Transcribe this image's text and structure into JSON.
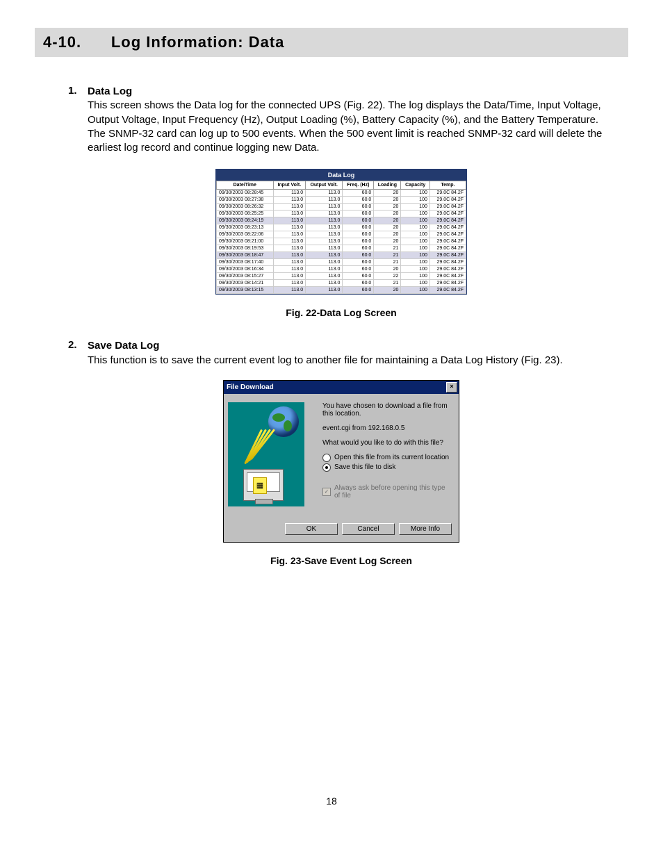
{
  "section": {
    "number": "4-10.",
    "title": "Log Information: Data"
  },
  "item1": {
    "num": "1.",
    "title": "Data Log",
    "body": "This screen shows the Data log for the connected UPS (Fig. 22).  The log displays the Data/Time, Input Voltage, Output Voltage, Input Frequency (Hz), Output Loading (%), Battery Capacity (%), and the Battery Temperature.  The SNMP-32 card can log up to 500 events.  When the 500 event limit is reached SNMP-32 card will delete the earliest log record and continue logging new Data."
  },
  "datalog": {
    "title": "Data Log",
    "headers": [
      "Date/Time",
      "Input Volt.",
      "Output Volt.",
      "Freq. (Hz)",
      "Loading",
      "Capacity",
      "Temp."
    ],
    "rows": [
      {
        "dt": "09/30/2003 08:28:45",
        "iv": "113.0",
        "ov": "113.0",
        "fr": "60.0",
        "ld": "20",
        "cp": "100",
        "tp": "29.0C 84.2F"
      },
      {
        "dt": "09/30/2003 08:27:38",
        "iv": "113.0",
        "ov": "113.0",
        "fr": "60.0",
        "ld": "20",
        "cp": "100",
        "tp": "29.0C 84.2F"
      },
      {
        "dt": "09/30/2003 08:26:32",
        "iv": "113.0",
        "ov": "113.0",
        "fr": "60.0",
        "ld": "20",
        "cp": "100",
        "tp": "29.0C 84.2F"
      },
      {
        "dt": "09/30/2003 08:25:25",
        "iv": "113.0",
        "ov": "113.0",
        "fr": "60.0",
        "ld": "20",
        "cp": "100",
        "tp": "29.0C 84.2F"
      },
      {
        "dt": "09/30/2003 08:24:19",
        "iv": "113.0",
        "ov": "113.0",
        "fr": "60.0",
        "ld": "20",
        "cp": "100",
        "tp": "29.0C 84.2F",
        "shade": true
      },
      {
        "dt": "09/30/2003 08:23:13",
        "iv": "113.0",
        "ov": "113.0",
        "fr": "60.0",
        "ld": "20",
        "cp": "100",
        "tp": "29.0C 84.2F"
      },
      {
        "dt": "09/30/2003 08:22:06",
        "iv": "113.0",
        "ov": "113.0",
        "fr": "60.0",
        "ld": "20",
        "cp": "100",
        "tp": "29.0C 84.2F"
      },
      {
        "dt": "09/30/2003 08:21:00",
        "iv": "113.0",
        "ov": "113.0",
        "fr": "60.0",
        "ld": "20",
        "cp": "100",
        "tp": "29.0C 84.2F"
      },
      {
        "dt": "09/30/2003 08:19:53",
        "iv": "113.0",
        "ov": "113.0",
        "fr": "60.0",
        "ld": "21",
        "cp": "100",
        "tp": "29.0C 84.2F"
      },
      {
        "dt": "09/30/2003 08:18:47",
        "iv": "113.0",
        "ov": "113.0",
        "fr": "60.0",
        "ld": "21",
        "cp": "100",
        "tp": "29.0C 84.2F",
        "shade": true
      },
      {
        "dt": "09/30/2003 08:17:40",
        "iv": "113.0",
        "ov": "113.0",
        "fr": "60.0",
        "ld": "21",
        "cp": "100",
        "tp": "29.0C 84.2F"
      },
      {
        "dt": "09/30/2003 08:16:34",
        "iv": "113.0",
        "ov": "113.0",
        "fr": "60.0",
        "ld": "20",
        "cp": "100",
        "tp": "29.0C 84.2F"
      },
      {
        "dt": "09/30/2003 08:15:27",
        "iv": "113.0",
        "ov": "113.0",
        "fr": "60.0",
        "ld": "22",
        "cp": "100",
        "tp": "29.0C 84.2F"
      },
      {
        "dt": "09/30/2003 08:14:21",
        "iv": "113.0",
        "ov": "113.0",
        "fr": "60.0",
        "ld": "21",
        "cp": "100",
        "tp": "29.0C 84.2F"
      },
      {
        "dt": "09/30/2003 08:13:15",
        "iv": "113.0",
        "ov": "113.0",
        "fr": "60.0",
        "ld": "20",
        "cp": "100",
        "tp": "29.0C 84.2F",
        "shade": true
      }
    ]
  },
  "fig22": "Fig. 22-Data Log Screen",
  "item2": {
    "num": "2.",
    "title": "Save Data Log",
    "body": "This function is to save the current event log to another file for maintaining a Data Log History (Fig. 23)."
  },
  "dialog": {
    "title": "File Download",
    "line1": "You have chosen to download a file from this location.",
    "line2": "event.cgi from 192.168.0.5",
    "line3": "What would you like to do with this file?",
    "opt1": "Open this file from its current location",
    "opt2": "Save this file to disk",
    "chk": "Always ask before opening this type of file",
    "ok": "OK",
    "cancel": "Cancel",
    "more": "More Info"
  },
  "fig23": "Fig. 23-Save Event Log Screen",
  "pageNum": "18"
}
